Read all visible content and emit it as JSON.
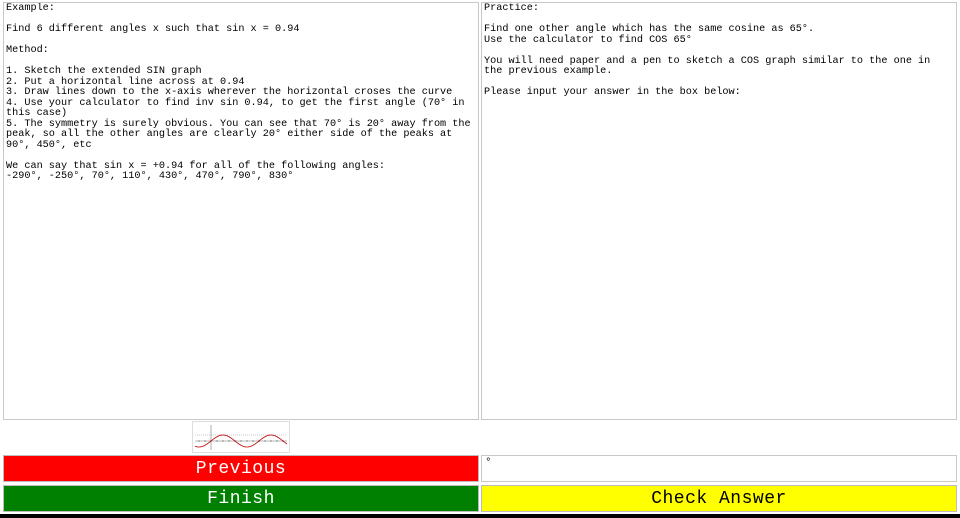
{
  "example": {
    "lines": [
      "Example:",
      "",
      "Find 6 different angles x such that sin x = 0.94",
      "",
      "Method:",
      "",
      "1. Sketch the extended SIN graph",
      "2. Put a horizontal line across at 0.94",
      "3. Draw lines down to the x-axis wherever the horizontal croses the curve",
      "4. Use your calculator to find inv sin 0.94, to get the first angle (70° in this case)",
      "5. The symmetry is surely obvious. You can see that 70° is 20° away from the peak, so all the other angles are clearly 20° either side of the peaks at 90°, 450°, etc",
      "",
      "We can say that sin x = +0.94 for all of the following angles:",
      "-290°, -250°, 70°, 110°, 430°, 470°, 790°, 830°"
    ]
  },
  "practice": {
    "lines": [
      "Practice:",
      "",
      "Find one other angle which has the same cosine as 65°.",
      "Use the calculator to find COS 65°",
      "",
      "You will need paper and a pen to sketch a COS graph similar to the one in the previous example.",
      "",
      "Please input your answer in the box below:"
    ]
  },
  "answer": {
    "value": "",
    "suffix": "°"
  },
  "buttons": {
    "previous": "Previous",
    "finish": "Finish",
    "check": "Check Answer"
  },
  "colors": {
    "previous": "#ff0000",
    "finish": "#008000",
    "check": "#ffff00",
    "curve": "#c00000"
  },
  "icons": {
    "thumbnail": "sine-graph-thumbnail"
  }
}
